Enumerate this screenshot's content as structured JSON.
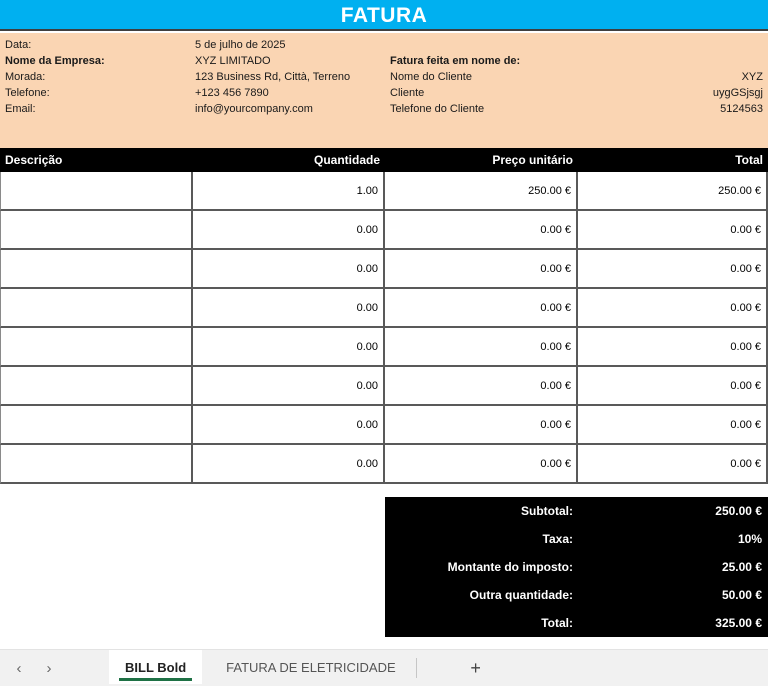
{
  "title": "FATURA",
  "company": {
    "rows": [
      {
        "label": "Data:",
        "value": "5 de julho de 2025"
      },
      {
        "label": "Nome da Empresa:",
        "value": "XYZ LIMITADO"
      },
      {
        "label": "Morada:",
        "value": "123 Business Rd, Città, Terreno"
      },
      {
        "label": "Telefone:",
        "value": "+123 456 7890"
      },
      {
        "label": "Email:",
        "value": "info@yourcompany.com"
      }
    ]
  },
  "client": {
    "heading": "Fatura feita em nome de:",
    "rows": [
      {
        "label": "Nome do Cliente",
        "value": "XYZ"
      },
      {
        "label": "Cliente",
        "value": "uygGSjsgj"
      },
      {
        "label": "Telefone do Cliente",
        "value": "5124563"
      }
    ]
  },
  "table": {
    "headers": [
      "Descrição",
      "Quantidade",
      "Preço unitário",
      "Total"
    ],
    "rows": [
      [
        "",
        "1.00",
        "250.00 €",
        "250.00 €"
      ],
      [
        "",
        "0.00",
        "0.00 €",
        "0.00 €"
      ],
      [
        "",
        "0.00",
        "0.00 €",
        "0.00 €"
      ],
      [
        "",
        "0.00",
        "0.00 €",
        "0.00 €"
      ],
      [
        "",
        "0.00",
        "0.00 €",
        "0.00 €"
      ],
      [
        "",
        "0.00",
        "0.00 €",
        "0.00 €"
      ],
      [
        "",
        "0.00",
        "0.00 €",
        "0.00 €"
      ],
      [
        "",
        "0.00",
        "0.00 €",
        "0.00 €"
      ]
    ]
  },
  "summary": {
    "rows": [
      {
        "label": "Subtotal:",
        "value": "250.00 €"
      },
      {
        "label": "Taxa:",
        "value": "10%"
      },
      {
        "label": "Montante do imposto:",
        "value": "25.00 €"
      },
      {
        "label": "Outra quantidade:",
        "value": "50.00 €"
      },
      {
        "label": "Total:",
        "value": "325.00 €"
      }
    ]
  },
  "tabbar": {
    "nav_prev": "‹",
    "nav_next": "›",
    "tabs": [
      {
        "label": "BILL Bold",
        "active": true
      },
      {
        "label": "FATURA DE ELETRICIDADE",
        "active": false
      }
    ],
    "add_label": "+"
  },
  "colors": {
    "header_blue": "#00B0F0",
    "info_peach": "#FAD5B3",
    "band_black": "#000000",
    "tab_green": "#1E7145",
    "border_gray": "#595959"
  }
}
